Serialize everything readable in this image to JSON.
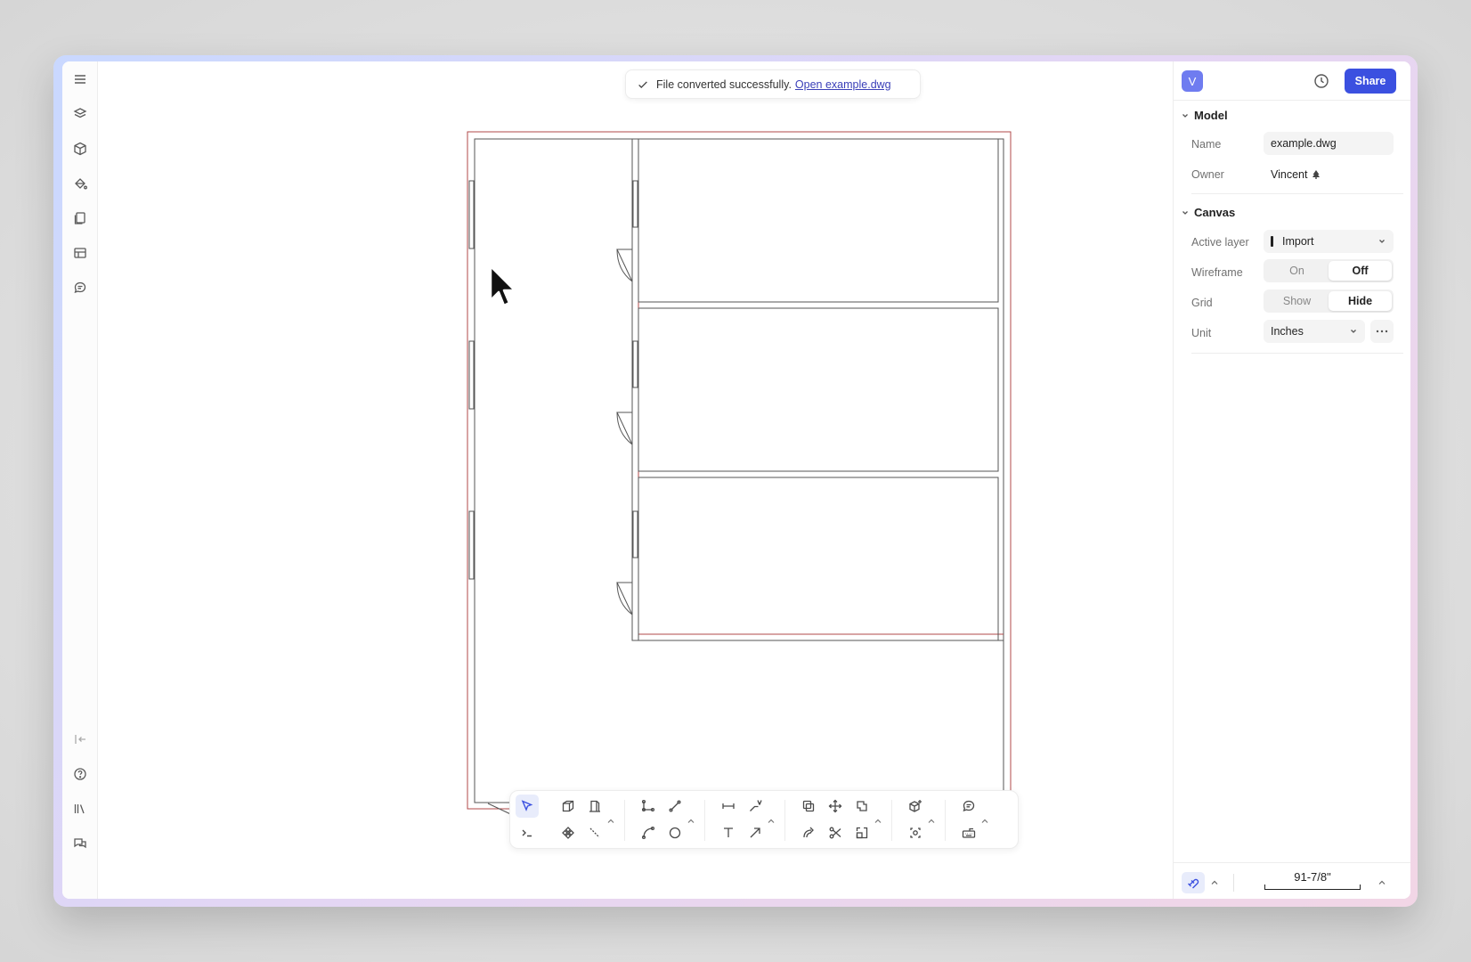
{
  "toast": {
    "message": "File converted successfully.",
    "link": "Open example.dwg"
  },
  "header": {
    "avatar_initial": "V",
    "share_label": "Share"
  },
  "model": {
    "title": "Model",
    "name_label": "Name",
    "name_value": "example.dwg",
    "owner_label": "Owner",
    "owner_value": "Vincent"
  },
  "canvas_settings": {
    "title": "Canvas",
    "active_layer_label": "Active layer",
    "active_layer_value": "Import",
    "wireframe_label": "Wireframe",
    "wireframe_on": "On",
    "wireframe_off": "Off",
    "wireframe_selected": "Off",
    "grid_label": "Grid",
    "grid_show": "Show",
    "grid_hide": "Hide",
    "grid_selected": "Hide",
    "unit_label": "Unit",
    "unit_value": "Inches"
  },
  "footer": {
    "scale_value": "91-7/8\""
  },
  "sidebar_icons": [
    "menu-icon",
    "layers-icon",
    "cube-icon",
    "paint-bucket-icon",
    "pages-icon",
    "table-icon",
    "comment-icon",
    "collapse-sidebar-icon",
    "help-icon",
    "library-icon",
    "chat-icon"
  ],
  "toolbar_icons": [
    "select-icon",
    "box-icon",
    "door-icon",
    "polyline-icon",
    "line-icon",
    "dimension-icon",
    "label-icon",
    "copy-icon",
    "move-icon",
    "duplicate-icon",
    "add-object-icon",
    "comment-icon",
    "terminal-icon",
    "component-icon",
    "measure-icon",
    "arc-icon",
    "circle-icon",
    "text-icon",
    "arrow-icon",
    "offset-icon",
    "scissors-icon",
    "scale-icon",
    "orbit-icon",
    "keyboard-icon"
  ],
  "colors": {
    "accent": "#3b50e0",
    "wall_outer": "#b04a4a",
    "wall_inner": "#555555"
  }
}
